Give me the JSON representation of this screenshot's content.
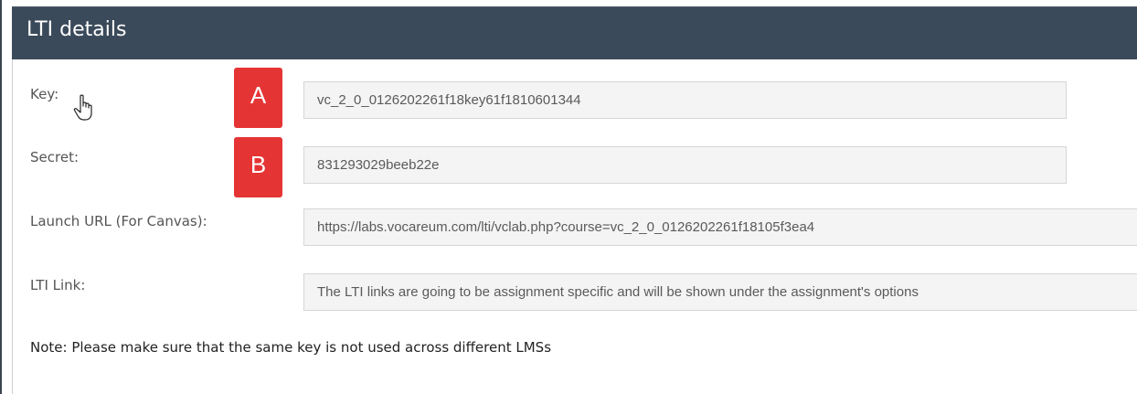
{
  "header": {
    "title": "LTI details"
  },
  "fields": {
    "key": {
      "label": "Key:",
      "value": "vc_2_0_0126202261f18key61f1810601344",
      "badge": "A"
    },
    "secret": {
      "label": "Secret:",
      "value": "831293029beeb22e",
      "badge": "B"
    },
    "launch_url": {
      "label": "Launch URL (For Canvas):",
      "value": "https://labs.vocareum.com/lti/vclab.php?course=vc_2_0_0126202261f18105f3ea4"
    },
    "lti_link": {
      "label": "LTI Link:",
      "value": "The LTI links are going to be assignment specific and will be shown under the assignment's options"
    }
  },
  "note": "Note: Please make sure that the same key is not used across different LMSs",
  "icons": {
    "cursor": "hand-pointer-icon"
  },
  "colors": {
    "header_bg": "#3b4a5a",
    "badge_bg": "#e53434",
    "field_bg": "#f4f4f4"
  }
}
